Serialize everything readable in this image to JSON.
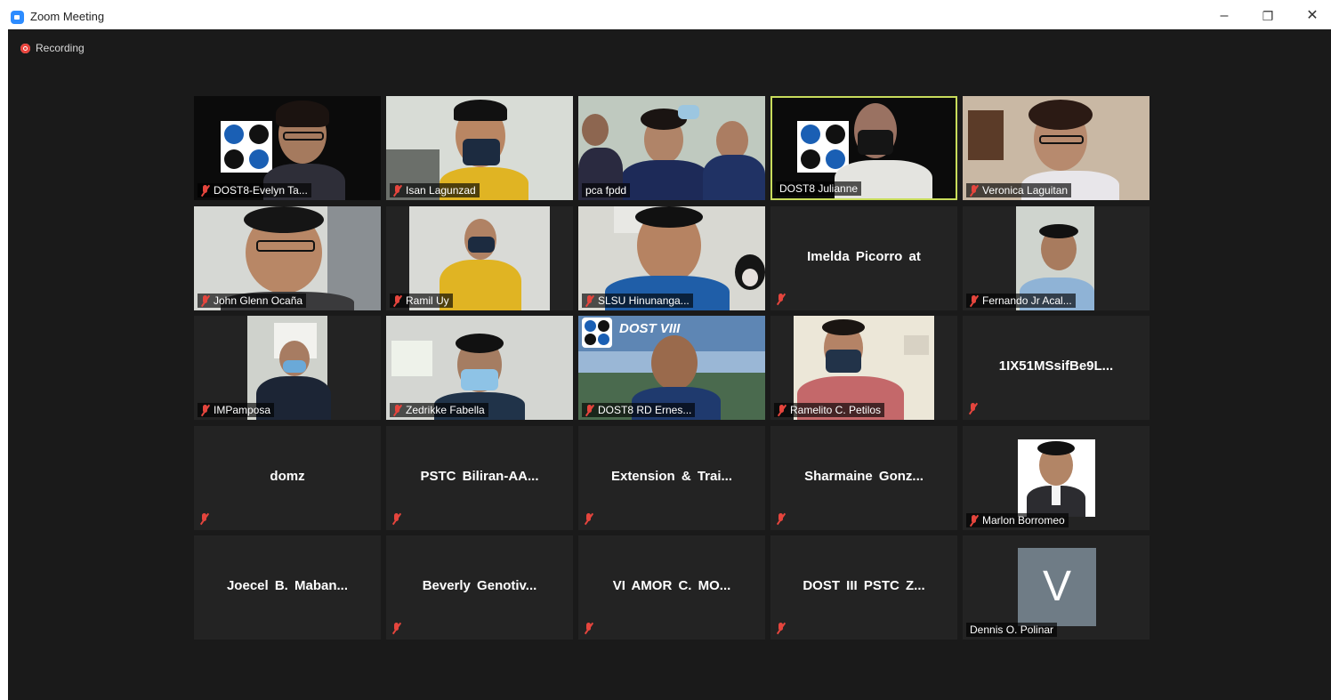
{
  "window": {
    "title": "Zoom Meeting",
    "controls": {
      "minimize": "–",
      "restore": "❐",
      "close": "✕"
    }
  },
  "recording": {
    "label": "Recording",
    "color": "#e8423b"
  },
  "colors": {
    "background": "#1a1a1a",
    "tile": "#232323",
    "active_speaker_border": "#c8dc5b",
    "muted_icon": "#e5453d"
  },
  "participants": [
    {
      "name": "DOST8-Evelyn Ta...",
      "video": true,
      "muted": true
    },
    {
      "name": "Isan Lagunzad",
      "video": true,
      "muted": true
    },
    {
      "name": "pca fpdd",
      "video": true,
      "muted": false
    },
    {
      "name": "DOST8 Julianne",
      "video": true,
      "muted": false,
      "active_speaker": true
    },
    {
      "name": "Veronica Laguitan",
      "video": true,
      "muted": true
    },
    {
      "name": "John Glenn Ocaña",
      "video": true,
      "muted": true
    },
    {
      "name": "Ramil Uy",
      "video": true,
      "muted": true
    },
    {
      "name": "SLSU Hinunanga...",
      "video": true,
      "muted": true
    },
    {
      "name": "Imelda Picorro at",
      "video": false,
      "muted": true
    },
    {
      "name": "Fernando Jr Acal...",
      "video": true,
      "muted": true
    },
    {
      "name": "IMPamposa",
      "video": true,
      "muted": true
    },
    {
      "name": "Zedrikke Fabella",
      "video": true,
      "muted": true
    },
    {
      "name": "DOST8 RD Ernes...",
      "video": true,
      "muted": true,
      "banner_text": "DOST VIII"
    },
    {
      "name": "Ramelito C. Petilos",
      "video": true,
      "muted": true
    },
    {
      "name": "1IX51MSsifBe9L...",
      "video": false,
      "muted": true
    },
    {
      "name": "domz",
      "video": false,
      "muted": true
    },
    {
      "name": "PSTC Biliran-AA...",
      "video": false,
      "muted": true
    },
    {
      "name": "Extension & Trai...",
      "video": false,
      "muted": true
    },
    {
      "name": "Sharmaine Gonz...",
      "video": false,
      "muted": true
    },
    {
      "name": "Marlon Borromeo",
      "video": true,
      "muted": true
    },
    {
      "name": "Joecel B. Maban...",
      "video": false,
      "muted": false
    },
    {
      "name": "Beverly Genotiv...",
      "video": false,
      "muted": true
    },
    {
      "name": "VI AMOR C. MO...",
      "video": false,
      "muted": true
    },
    {
      "name": "DOST III PSTC Z...",
      "video": false,
      "muted": true
    },
    {
      "name": "Dennis O. Polinar",
      "video": true,
      "muted": false,
      "avatar_letter": "V"
    }
  ]
}
